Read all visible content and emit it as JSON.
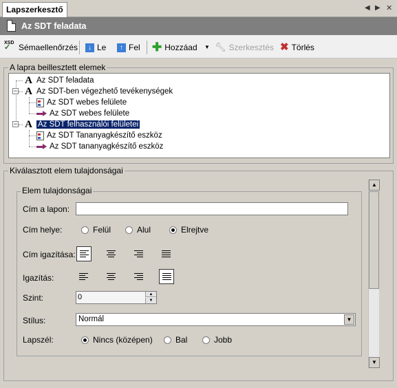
{
  "tab": {
    "label": "Lapszerkesztő"
  },
  "tab_nav": {
    "prev": "◀",
    "next": "▶",
    "close": "✕"
  },
  "title": {
    "text": "Az SDT feladata"
  },
  "toolbar": {
    "schema_check": "Sémaellenőrzés",
    "schema_icon_text": "XSD",
    "down": "Le",
    "up": "Fel",
    "add": "Hozzáad",
    "edit": "Szerkesztés",
    "delete": "Törlés"
  },
  "embedded": {
    "group_label": "A lapra beillesztett elemek",
    "items": [
      {
        "label": "Az SDT feladata",
        "icon": "A"
      },
      {
        "label": "Az SDT-ben végezhető tevékenységek",
        "icon": "A",
        "expander": "−"
      },
      {
        "label": "Az SDT webes felülete",
        "icon": "page-icon"
      },
      {
        "label": "Az SDT webes felülete",
        "icon": "link-icon"
      },
      {
        "label": "Az SDT felhasználói felületei",
        "icon": "A",
        "expander": "−",
        "selected": true
      },
      {
        "label": "Az SDT Tananyagkészítő eszköz",
        "icon": "page-icon"
      },
      {
        "label": "Az SDT tananyagkészítő eszköz",
        "icon": "link-icon"
      }
    ]
  },
  "selected_props": {
    "group_label": "Kiválasztott elem tulajdonságai",
    "inner_label": "Elem tulajdonságai",
    "title_on_page_label": "Cím a lapon:",
    "title_on_page_value": "",
    "title_position_label": "Cím helye:",
    "title_position_options": [
      "Felül",
      "Alul",
      "Elrejtve"
    ],
    "title_position_selected": "Elrejtve",
    "title_align_label": "Cím igazítása:",
    "align_label": "Igazítás:",
    "level_label": "Szint:",
    "level_value": "0",
    "style_label": "Stílus:",
    "style_value": "Normál",
    "margin_label": "Lapszél:",
    "margin_options": [
      "Nincs (középen)",
      "Bal",
      "Jobb"
    ],
    "margin_selected": "Nincs (középen)"
  },
  "colors": {
    "title_bar": "#7f7f7f",
    "selection": "#0a246a",
    "add_icon": "#2ca02c",
    "delete_icon": "#c03030"
  }
}
